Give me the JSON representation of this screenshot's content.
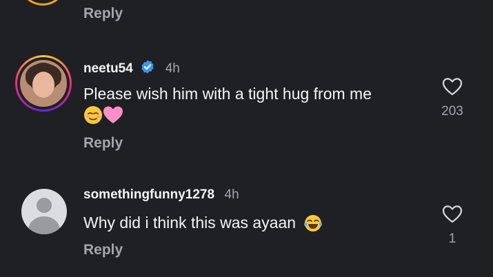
{
  "reply_label": "Reply",
  "comments": [
    {
      "username": "neetu54",
      "verified": true,
      "time": "4h",
      "text": "Please wish him with a tight hug from me",
      "emojis": [
        "relieved-face",
        "pink-heart"
      ],
      "likes": "203",
      "avatar": "profile-photo-with-story-ring"
    },
    {
      "username": "somethingfunny1278",
      "verified": false,
      "time": "4h",
      "text": "Why did i think this was ayaan",
      "emojis": [
        "tears-of-joy-face"
      ],
      "likes": "1",
      "avatar": "default-avatar"
    }
  ],
  "colors": {
    "background": "#1f2024",
    "secondary_text": "#a3a6ad",
    "verified_badge": "#3897f0",
    "story_ring_accent": "#ee2a7b"
  }
}
